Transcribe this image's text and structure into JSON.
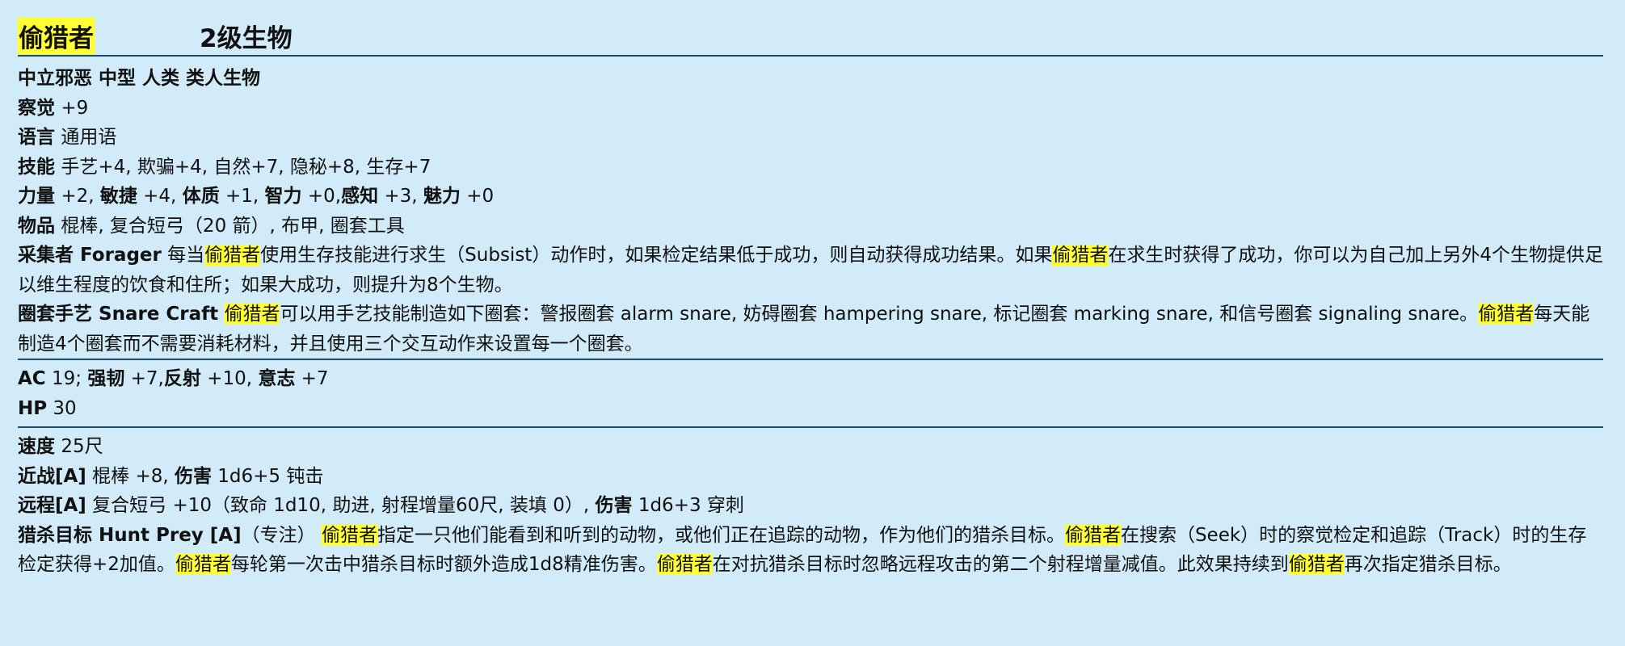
{
  "header": {
    "name": "偷猎者",
    "level": "2级生物"
  },
  "traits": "中立邪恶 中型 人类 类人生物",
  "stats": {
    "perception_label": "察觉",
    "perception_value": "+9",
    "language_label": "语言",
    "language_value": "通用语",
    "skills_label": "技能",
    "skills_value": "手艺+4, 欺骗+4, 自然+7, 隐秘+8, 生存+7",
    "str_label": "力量",
    "str_value": "+2,",
    "dex_label": "敏捷",
    "dex_value": "+4,",
    "con_label": "体质",
    "con_value": "+1,",
    "int_label": "智力",
    "int_value": "+0,",
    "wis_label": "感知",
    "wis_value": "+3,",
    "cha_label": "魅力",
    "cha_value": "+0",
    "items_label": "物品",
    "items_value": "棍棒, 复合短弓（20 箭）, 布甲, 圈套工具"
  },
  "forager": {
    "label": "采集者 Forager",
    "t1": "每当",
    "t2": "使用生存技能进行求生（Subsist）动作时，如果检定结果低于成功，则自动获得成功结果。如果",
    "t3": "在求生时获得了成功，你可以为自己加上另外4个生物提供足以维生程度的饮食和住所；如果大成功，则提升为8个生物。"
  },
  "snare": {
    "label": "圈套手艺 Snare Craft",
    "t1": "可以用手艺技能制造如下圈套：警报圈套 alarm snare, 妨碍圈套 hampering snare, 标记圈套 marking snare, 和信号圈套 signaling snare。",
    "t2": "每天能制造4个圈套而不需要消耗材料，并且使用三个交互动作来设置每一个圈套。"
  },
  "defense": {
    "ac_label": "AC",
    "ac_value": "19;",
    "fort_label": "强韧",
    "fort_value": "+7,",
    "ref_label": "反射",
    "ref_value": "+10,",
    "will_label": "意志",
    "will_value": "+7",
    "hp_label": "HP",
    "hp_value": "30"
  },
  "offense": {
    "speed_label": "速度",
    "speed_value": "25尺",
    "melee_label": "近战[A]",
    "melee_value": "棍棒 +8,",
    "melee_damage_label": "伤害",
    "melee_damage_value": "1d6+5 钝击",
    "ranged_label": "远程[A]",
    "ranged_value": "复合短弓 +10（致命 1d10, 助进, 射程增量60尺, 装填 0）,",
    "ranged_damage_label": "伤害",
    "ranged_damage_value": "1d6+3 穿刺"
  },
  "hunt_prey": {
    "label": "猎杀目标 Hunt Prey [A]",
    "t0": "（专注）",
    "t1": "指定一只他们能看到和听到的动物，或他们正在追踪的动物，作为他们的猎杀目标。",
    "t2": "在搜索（Seek）时的察觉检定和追踪（Track）时的生存检定获得+2加值。",
    "t3": "每轮第一次击中猎杀目标时额外造成1d8精准伤害。",
    "t4": "在对抗猎杀目标时忽略远程攻击的第二个射程增量减值。此效果持续到",
    "t5": "再次指定猎杀目标。"
  }
}
